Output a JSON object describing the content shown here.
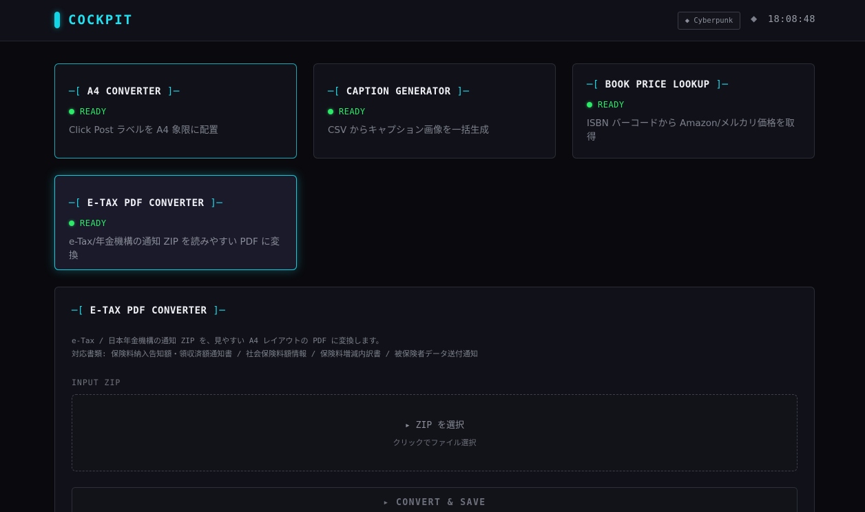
{
  "header": {
    "title": "COCKPIT",
    "theme_badge": "◆ Cyberpunk",
    "separator": "◆",
    "time": "18:08:48"
  },
  "bracket_open": "─[",
  "bracket_close": "]─",
  "cards": [
    {
      "title": "A4 CONVERTER",
      "status": "READY",
      "desc": "Click Post ラベルを A4 象限に配置"
    },
    {
      "title": "CAPTION GENERATOR",
      "status": "READY",
      "desc": "CSV からキャプション画像を一括生成"
    },
    {
      "title": "BOOK PRICE LOOKUP",
      "status": "READY",
      "desc": "ISBN バーコードから Amazon/メルカリ価格を取得"
    },
    {
      "title": "E-TAX PDF CONVERTER",
      "status": "READY",
      "desc": "e-Tax/年金機構の通知 ZIP を読みやすい PDF に変換"
    }
  ],
  "panel": {
    "title": "E-TAX PDF CONVERTER",
    "desc_line1": "e-Tax / 日本年金機構の通知 ZIP を、見やすい A4 レイアウトの PDF に変換します。",
    "desc_line2": "対応書類: 保険料納入告知額・領収済額通知書 / 社会保険料額情報 / 保険料増減内訳書 / 被保険者データ送付通知",
    "input_label": "INPUT ZIP",
    "dropzone_main": "▸ ZIP を選択",
    "dropzone_sub": "クリックでファイル選択",
    "convert_label": "▸ CONVERT & SAVE"
  },
  "colors": {
    "accent": "#20d4e4",
    "ready": "#2ee86a",
    "background": "#0a0a0e"
  }
}
